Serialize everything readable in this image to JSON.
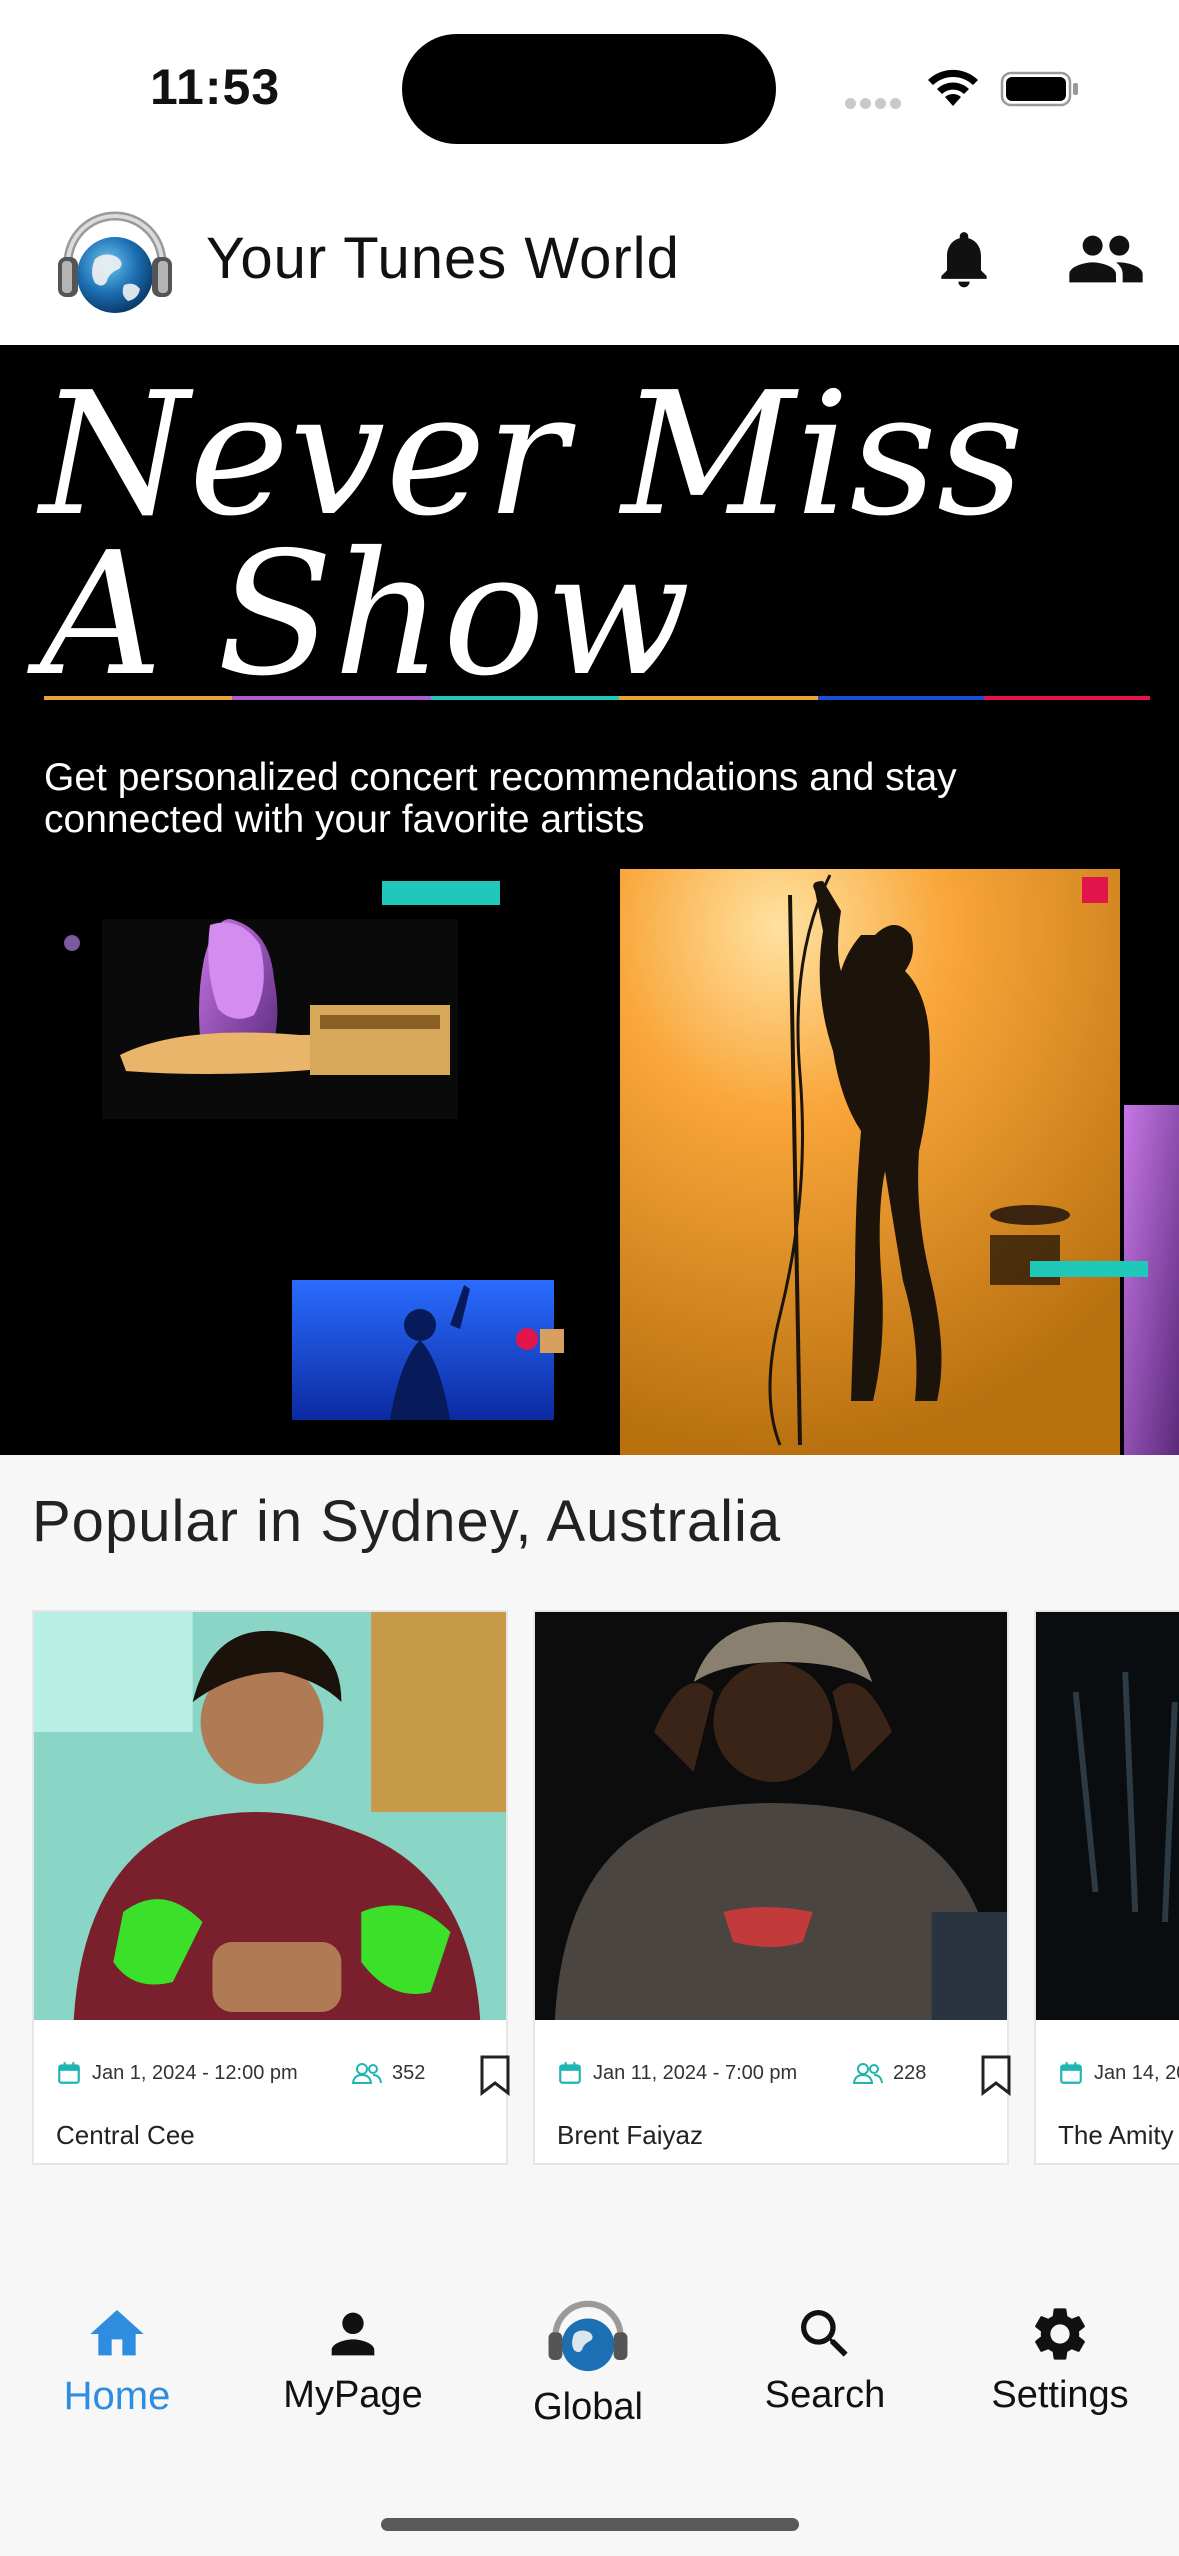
{
  "status_bar": {
    "time": "11:53",
    "icons": [
      "cellular-signal-icon",
      "wifi-icon",
      "battery-icon"
    ]
  },
  "header": {
    "app_title": "Your Tunes World",
    "logo": "globe-headphones-logo",
    "actions": [
      "bell-icon",
      "people-icon"
    ]
  },
  "hero": {
    "title_line1": "Never Miss",
    "title_line2": "A Show",
    "subtitle": "Get personalized concert recommendations and stay connected with your favorite artists",
    "accent_colors": [
      "#e9a43a",
      "#b05bd4",
      "#22c9b8",
      "#1a4fd8",
      "#e2154a"
    ]
  },
  "section": {
    "title": "Popular in Sydney, Australia"
  },
  "events": [
    {
      "date": "Jan 1, 2024 - 12:00 pm",
      "attendees": "352",
      "name": "Central Cee"
    },
    {
      "date": "Jan 11, 2024 - 7:00 pm",
      "attendees": "228",
      "name": "Brent Faiyaz"
    },
    {
      "date": "Jan 14, 20",
      "attendees": "",
      "name": "The Amity"
    }
  ],
  "nav": {
    "items": [
      {
        "label": "Home",
        "icon": "home-icon",
        "active": true
      },
      {
        "label": "MyPage",
        "icon": "person-icon",
        "active": false
      },
      {
        "label": "Global",
        "icon": "globe-headphones-icon",
        "active": false
      },
      {
        "label": "Search",
        "icon": "search-icon",
        "active": false
      },
      {
        "label": "Settings",
        "icon": "gear-icon",
        "active": false
      }
    ],
    "active_color": "#2f8de0"
  }
}
